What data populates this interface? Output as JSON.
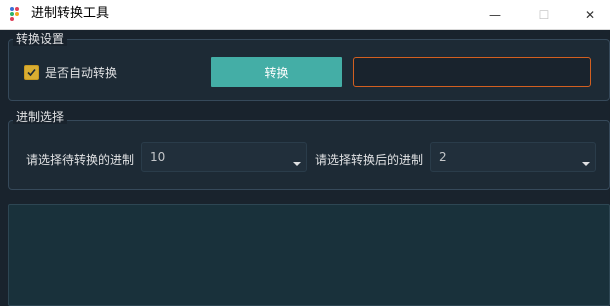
{
  "window": {
    "title": "进制转换工具",
    "controls": {
      "minimize": "—",
      "maximize": "☐",
      "close": "✕"
    }
  },
  "convert_settings": {
    "group_title": "转换设置",
    "auto_convert_label": "是否自动转换",
    "auto_convert_checked": true,
    "convert_button_label": "转换",
    "input_value": ""
  },
  "base_select": {
    "group_title": "进制选择",
    "from_label": "请选择待转换的进制",
    "from_value": "10",
    "to_label": "请选择转换后的进制",
    "to_value": "2"
  },
  "output": {
    "text": ""
  },
  "colors": {
    "accent_button": "#44aea6",
    "checkbox": "#d9ad32",
    "input_border_focus": "#d25f20",
    "background": "#19232d"
  }
}
